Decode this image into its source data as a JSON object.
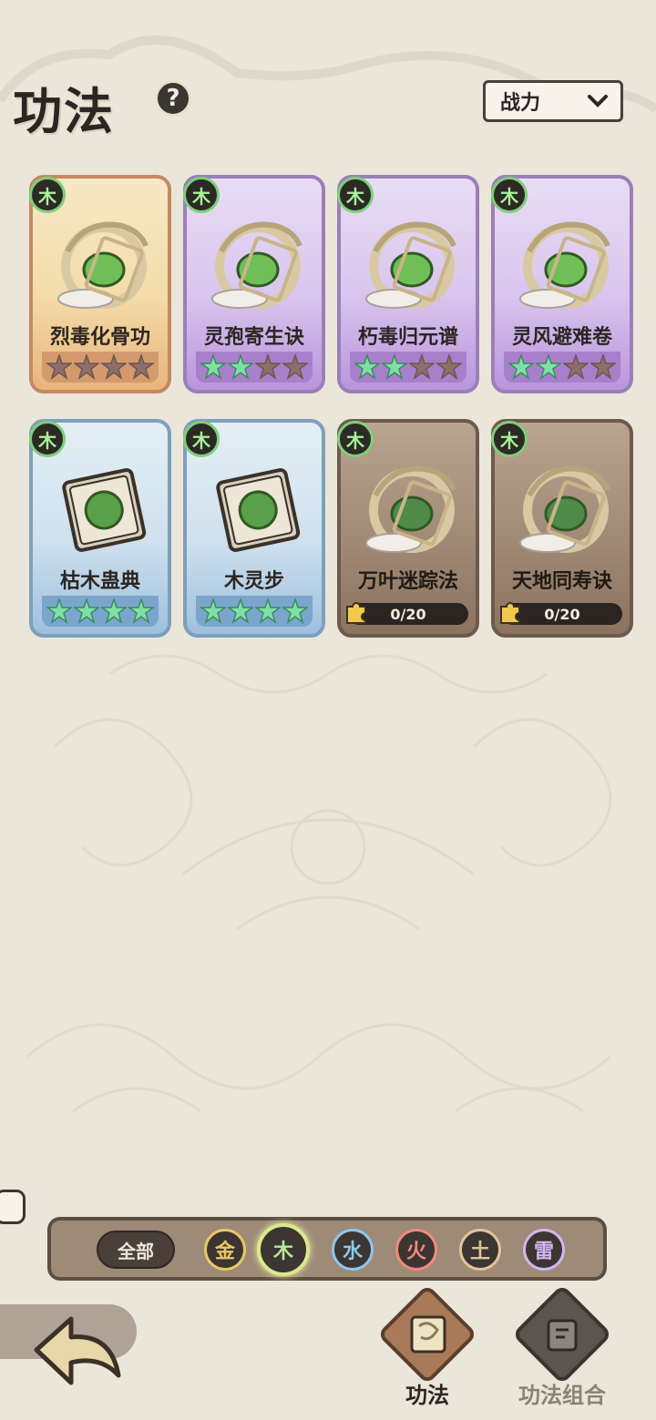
{
  "header": {
    "title": "功法",
    "help_icon": "?",
    "sort_label": "战力"
  },
  "cards": [
    {
      "name": "烈毒化骨功",
      "element": "木",
      "rarity": "orange",
      "stars_lit": 0,
      "stars_total": 4,
      "locked": false
    },
    {
      "name": "灵孢寄生诀",
      "element": "木",
      "rarity": "purple",
      "stars_lit": 2,
      "stars_total": 4,
      "locked": false
    },
    {
      "name": "朽毒归元谱",
      "element": "木",
      "rarity": "purple",
      "stars_lit": 2,
      "stars_total": 4,
      "locked": false
    },
    {
      "name": "灵风避难卷",
      "element": "木",
      "rarity": "purple",
      "stars_lit": 2,
      "stars_total": 4,
      "locked": false
    },
    {
      "name": "枯木蛊典",
      "element": "木",
      "rarity": "blue",
      "stars_lit": 4,
      "stars_total": 4,
      "locked": false
    },
    {
      "name": "木灵步",
      "element": "木",
      "rarity": "blue",
      "stars_lit": 4,
      "stars_total": 4,
      "locked": false
    },
    {
      "name": "万叶迷踪法",
      "element": "木",
      "rarity": "brown",
      "locked": true,
      "progress": "0/20"
    },
    {
      "name": "天地同寿诀",
      "element": "木",
      "rarity": "brown",
      "locked": true,
      "progress": "0/20"
    }
  ],
  "filters": {
    "all_label": "全部",
    "elements": [
      {
        "label": "金",
        "color": "#e8c766",
        "active": false
      },
      {
        "label": "木",
        "color": "#b8e89a",
        "active": true
      },
      {
        "label": "水",
        "color": "#8cc7f0",
        "active": false
      },
      {
        "label": "火",
        "color": "#f08a7a",
        "active": false
      },
      {
        "label": "土",
        "color": "#e2c49a",
        "active": false
      },
      {
        "label": "雷",
        "color": "#d4b4f0",
        "active": false
      }
    ]
  },
  "nav": {
    "tab1_label": "功法",
    "tab2_label": "功法组合"
  },
  "colors": {
    "star_lit": "#7fe0a6",
    "star_dim": "#8c6f6a"
  }
}
